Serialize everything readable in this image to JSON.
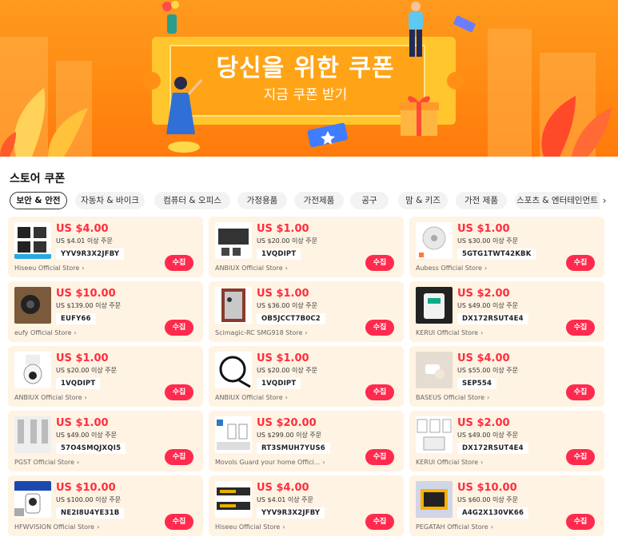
{
  "banner": {
    "title": "당신을 위한 쿠폰",
    "subtitle": "지금 쿠폰 받기"
  },
  "section": {
    "title": "스토어 쿠폰"
  },
  "tabs": [
    {
      "label": "보안 & 안전",
      "active": true
    },
    {
      "label": "자동차 & 바이크"
    },
    {
      "label": "컴퓨터 & 오피스"
    },
    {
      "label": "가정용품"
    },
    {
      "label": "가전제품"
    },
    {
      "label": "공구"
    },
    {
      "label": "맘 & 키즈"
    },
    {
      "label": "가전 제품"
    },
    {
      "label": "스포츠 & 엔터테인먼트"
    }
  ],
  "tab_more_icon": "chevron-right-icon",
  "collect_label": "수집",
  "coupons": [
    {
      "amount": "US $4.00",
      "condition": "US $4.01 이상 주문",
      "code": "YYV9R3X2JFBY",
      "store": "Hiseeu Official Store"
    },
    {
      "amount": "US $1.00",
      "condition": "US $20.00 이상 주문",
      "code": "1VQDIPT",
      "store": "ANBIUX Official Store"
    },
    {
      "amount": "US $1.00",
      "condition": "US $30.00 이상 주문",
      "code": "5GTG1TWT42KBK",
      "store": "Aubess Official Store"
    },
    {
      "amount": "US $10.00",
      "condition": "US $139.00 이상 주문",
      "code": "EUFY66",
      "store": "eufy Official Store"
    },
    {
      "amount": "US $1.00",
      "condition": "US $36.00 이상 주문",
      "code": "OB5JCCT7B0C2",
      "store": "Scimagic-RC SMG918 Store"
    },
    {
      "amount": "US $2.00",
      "condition": "US $49.00 이상 주문",
      "code": "DX172RSUT4E4",
      "store": "KERUI Official Store"
    },
    {
      "amount": "US $1.00",
      "condition": "US $20.00 이상 주문",
      "code": "1VQDIPT",
      "store": "ANBIUX Official Store"
    },
    {
      "amount": "US $1.00",
      "condition": "US $20.00 이상 주문",
      "code": "1VQDIPT",
      "store": "ANBIUX Official Store"
    },
    {
      "amount": "US $4.00",
      "condition": "US $55.00 이상 주문",
      "code": "SEP554",
      "store": "BASEUS Official Store"
    },
    {
      "amount": "US $1.00",
      "condition": "US $49.00 이상 주문",
      "code": "57O4SMQJXQI5",
      "store": "PGST Official Store"
    },
    {
      "amount": "US $20.00",
      "condition": "US $299.00 이상 주문",
      "code": "RT3SMUH7YUS6",
      "store": "Movols Guard your home Offici..."
    },
    {
      "amount": "US $2.00",
      "condition": "US $49.00 이상 주문",
      "code": "DX172RSUT4E4",
      "store": "KERUI Official Store"
    },
    {
      "amount": "US $10.00",
      "condition": "US $100.00 이상 주문",
      "code": "NE2I8U4YE31B",
      "store": "HFWVISION Official Store"
    },
    {
      "amount": "US $4.00",
      "condition": "US $4.01 이상 주문",
      "code": "YYV9R3X2JFBY",
      "store": "Hiseeu Official Store"
    },
    {
      "amount": "US $10.00",
      "condition": "US $60.00 이상 주문",
      "code": "A4G2X130VK66",
      "store": "PEGATAH Official Store"
    }
  ],
  "colors": {
    "accent": "#ff2a4d",
    "price": "#ff2d3d",
    "card_bg": "#fff3e3",
    "banner": "#ff8a12"
  }
}
